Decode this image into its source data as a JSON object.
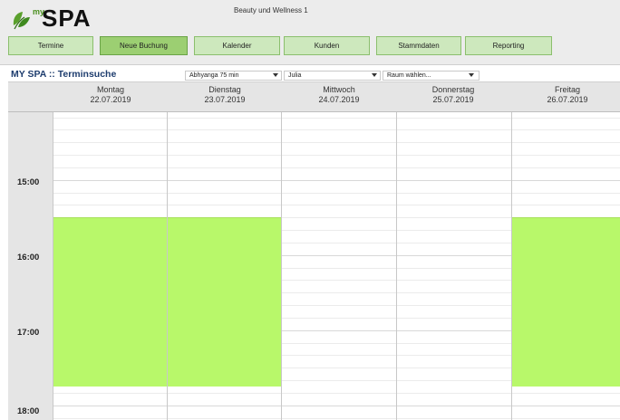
{
  "app": {
    "logo_my": "my",
    "logo_spa": "SPA",
    "title": "Beauty und Wellness 1"
  },
  "nav": [
    {
      "label": "Termine",
      "active": false
    },
    {
      "label": "Neue Buchung",
      "active": true
    },
    {
      "label": "Kalender",
      "active": false
    },
    {
      "label": "Kunden",
      "active": false
    },
    {
      "label": "Stammdaten",
      "active": false
    },
    {
      "label": "Reporting",
      "active": false
    }
  ],
  "toolbar": {
    "page_title": "MY SPA :: Terminsuche",
    "treatment_select": "Abhyanga 75 min",
    "therapist_select": "Julia",
    "room_select": "Raum wählen..."
  },
  "calendar": {
    "days": [
      {
        "name": "Montag",
        "date": "22.07.2019",
        "slots": [
          {
            "from": "15:30",
            "to": "17:45"
          }
        ]
      },
      {
        "name": "Dienstag",
        "date": "23.07.2019",
        "slots": [
          {
            "from": "15:30",
            "to": "17:45"
          }
        ]
      },
      {
        "name": "Mittwoch",
        "date": "24.07.2019",
        "slots": []
      },
      {
        "name": "Donnerstag",
        "date": "25.07.2019",
        "slots": []
      },
      {
        "name": "Freitag",
        "date": "26.07.2019",
        "slots": [
          {
            "from": "15:30",
            "to": "17:45"
          }
        ]
      }
    ],
    "hours": [
      "15:00",
      "16:00",
      "17:00",
      "18:00"
    ]
  },
  "colors": {
    "available_slot": "#b8f86a",
    "nav_button": "#cde8bd",
    "nav_button_active": "#9ccf72",
    "title_blue": "#1e3d6e"
  }
}
